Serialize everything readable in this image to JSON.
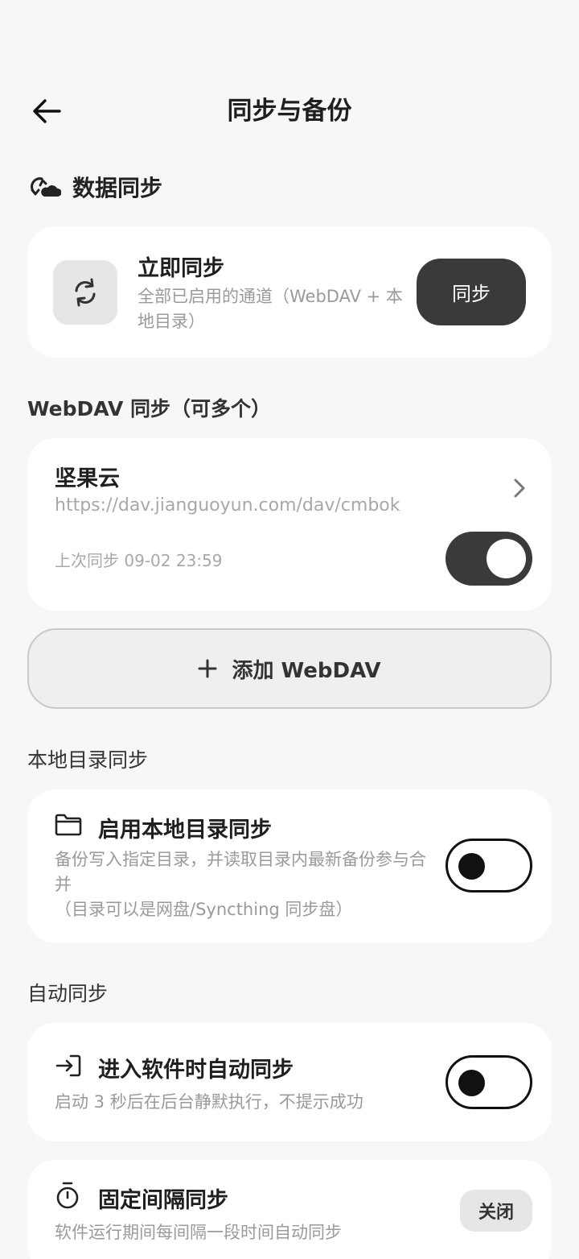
{
  "header": {
    "title": "同步与备份"
  },
  "data_sync": {
    "section_title": "数据同步",
    "sync_now": {
      "title": "立即同步",
      "description": "全部已启用的通道（WebDAV + 本地目录）",
      "button_label": "同步"
    }
  },
  "webdav": {
    "section_title": "WebDAV 同步（可多个）",
    "items": [
      {
        "name": "坚果云",
        "url": "https://dav.jianguoyun.com/dav/cmbok",
        "last_sync": "上次同步 09-02 23:59",
        "enabled": true
      }
    ],
    "add_label": "添加 WebDAV"
  },
  "local_dir": {
    "section_title": "本地目录同步",
    "title": "启用本地目录同步",
    "description": "备份写入指定目录，并读取目录内最新备份参与合并\n（目录可以是网盘/Syncthing 同步盘）",
    "enabled": false
  },
  "auto_sync": {
    "section_title": "自动同步",
    "on_enter": {
      "title": "进入软件时自动同步",
      "description": "启动 3 秒后在后台静默执行，不提示成功",
      "enabled": false
    },
    "interval": {
      "title": "固定间隔同步",
      "description": "软件运行期间每间隔一段时间自动同步",
      "value_label": "关闭"
    }
  },
  "colors": {
    "background": "#f7f7f7",
    "card": "#ffffff",
    "dark_button": "#3a3a3a",
    "muted_text": "#9a9a9a"
  }
}
